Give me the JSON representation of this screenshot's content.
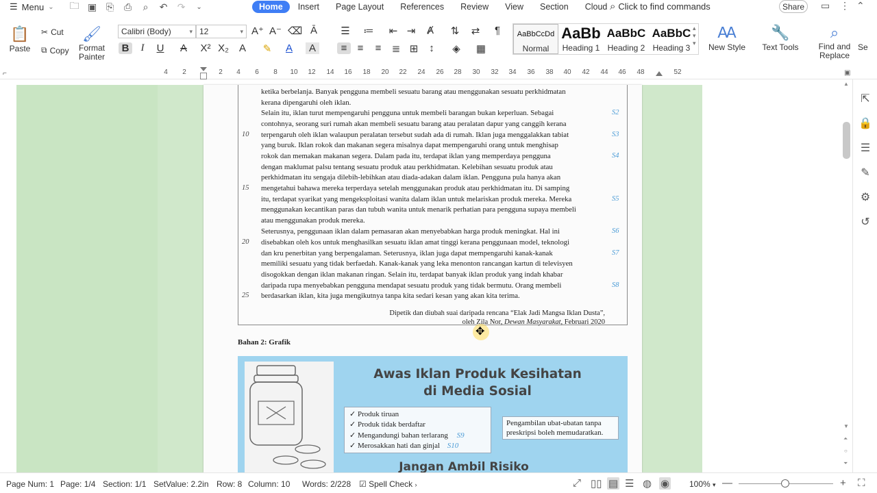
{
  "menubar": {
    "menu_label": "Menu",
    "tabs": [
      "Home",
      "Insert",
      "Page Layout",
      "References",
      "Review",
      "View",
      "Section",
      "Cloud"
    ],
    "find_commands": "Click to find commands",
    "share": "Share"
  },
  "ribbon": {
    "paste": "Paste",
    "cut": "Cut",
    "copy": "Copy",
    "format_painter_1": "Format",
    "format_painter_2": "Painter",
    "font_name": "Calibri (Body)",
    "font_size": "12",
    "styles": [
      {
        "preview": "AaBbCcDd",
        "label": "Normal"
      },
      {
        "preview": "AaBb",
        "label": "Heading 1"
      },
      {
        "preview": "AaBbC",
        "label": "Heading 2"
      },
      {
        "preview": "AaBbC",
        "label": "Heading 3"
      }
    ],
    "new_style": "New Style",
    "text_tools": "Text Tools",
    "find_replace_1": "Find and",
    "find_replace_2": "Replace",
    "select_partial": "Se"
  },
  "ruler": {
    "ticks": [
      "4",
      "2",
      "2",
      "4",
      "6",
      "8",
      "10",
      "12",
      "14",
      "16",
      "18",
      "20",
      "22",
      "24",
      "26",
      "28",
      "30",
      "32",
      "34",
      "36",
      "38",
      "40",
      "42",
      "44",
      "46",
      "48",
      "52"
    ]
  },
  "document": {
    "lines": [
      "ketika berbelanja. Banyak pengguna membeli sesuatu barang atau menggunakan sesuatu perkhidmatan",
      "kerana dipengaruhi oleh iklan.",
      "      Selain itu, iklan turut mempengaruhi pengguna untuk membeli barangan bukan keperluan. Sebagai",
      "contohnya,  seorang suri rumah akan membeli sesuatu barang atau peralatan dapur yang canggih kerana",
      "terpengaruh oleh iklan walaupun peralatan tersebut sudah ada di rumah. Iklan juga menggalakkan tabiat",
      "yang buruk. Iklan rokok dan makanan segera misalnya dapat mempengaruhi orang untuk menghisap",
      "rokok dan memakan makanan segera. Dalam pada itu, terdapat iklan yang memperdaya pengguna",
      "dengan maklumat palsu tentang sesuatu produk atau perkhidmatan. Kelebihan sesuatu produk atau",
      "perkhidmatan itu sengaja dilebih-lebihkan atau diada-adakan dalam iklan. Pengguna pula hanya akan",
      "mengetahui bahawa mereka terperdaya setelah menggunakan produk atau perkhidmatan itu. Di samping",
      "itu, terdapat syarikat yang mengeksploitasi wanita dalam iklan untuk melariskan produk mereka. Mereka",
      "menggunakan kecantikan paras dan tubuh wanita untuk menarik perhatian para pengguna supaya membeli",
      "atau menggunakan produk mereka.",
      "      Seterusnya, penggunaan iklan dalam pemasaran akan menyebabkan harga produk meningkat. Hal ini",
      "disebabkan oleh kos untuk menghasilkan sesuatu iklan amat tinggi kerana penggunaan model, teknologi",
      "dan kru penerbitan yang berpengalaman. Seterusnya, iklan juga dapat mempengaruhi kanak-kanak",
      "memiliki sesuatu yang tidak berfaedah. Kanak-kanak yang leka menonton rancangan kartun di televisyen",
      "disogokkan dengan iklan makanan ringan. Selain itu, terdapat banyak iklan produk yang indah khabar",
      "daripada rupa menyebabkan pengguna mendapat sesuatu produk yang tidak bermutu. Orang membeli",
      "berdasarkan iklan, kita juga mengikutnya tanpa kita sedari kesan yang akan kita terima."
    ],
    "line_numbers": [
      "10",
      "15",
      "20",
      "25"
    ],
    "s_marks": [
      "S2",
      "S3",
      "S4",
      "S5",
      "S6",
      "S7",
      "S8"
    ],
    "credit_1": "Dipetik dan diubah suai daripada rencana “Elak Jadi Mangsa Iklan Dusta”,",
    "credit_2a": "oleh Zila Nor, ",
    "credit_2b": "Dewan Masyarakat,",
    "credit_2c": " Februari 2020",
    "bahan_label": "Bahan 2: Grafik",
    "poster": {
      "title_1": "Awas Iklan Produk Kesihatan",
      "title_2": "di Media Sosial",
      "checks": [
        "Produk tiruan",
        "Produk tidak berdaftar",
        "Mengandungi bahan terlarang",
        "Merosakkan hati dan ginjal"
      ],
      "check_marks": [
        "S9",
        "S10"
      ],
      "note": "Pengambilan ubat-ubatan tanpa preskripsi boleh memudaratkan.",
      "bottom": "Jangan Ambil Risiko"
    }
  },
  "statusbar": {
    "page_num": "Page Num: 1",
    "page": "Page: 1/4",
    "section": "Section: 1/1",
    "setvalue": "SetValue: 2.2in",
    "row": "Row: 8",
    "column": "Column: 10",
    "words": "Words: 2/228",
    "spell_check": "Spell Check",
    "zoom": "100%"
  },
  "colors": {
    "accent": "#3f7ef5",
    "page_background": "#c9e5c3",
    "poster_background": "#9fd4ef",
    "s_mark": "#4a9bd6"
  }
}
